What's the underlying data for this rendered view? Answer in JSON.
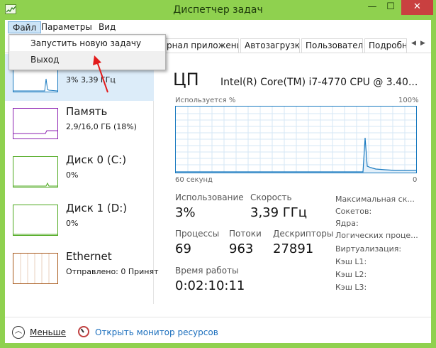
{
  "window": {
    "title": "Диспетчер задач",
    "controls": {
      "minimize": "—",
      "maximize": "☐",
      "close": "✕"
    }
  },
  "menubar": {
    "file": "Файл",
    "params": "Параметры",
    "view": "Вид"
  },
  "file_menu": {
    "items": [
      "Запустить новую задачу",
      "Выход"
    ]
  },
  "tabs": [
    "рнал приложений",
    "Автозагрузка",
    "Пользователи",
    "Подробно"
  ],
  "resources": [
    {
      "name": "ЦП",
      "value": "3%  3,39 ГГц",
      "color": "#1a7ac0"
    },
    {
      "name": "Память",
      "value": "2,9/16,0 ГБ (18%)",
      "color": "#8b1fb0"
    },
    {
      "name": "Диск 0 (C:)",
      "value": "0%",
      "color": "#4ca81c"
    },
    {
      "name": "Диск 1 (D:)",
      "value": "0%",
      "color": "#4ca81c"
    },
    {
      "name": "Ethernet",
      "value": "Отправлено: 0 Принят",
      "color": "#a7581a"
    }
  ],
  "cpu": {
    "heading": "ЦП",
    "model": "Intel(R) Core(TM) i7-4770 CPU @ 3.40...",
    "graph_top_label": "Используется %",
    "graph_max_label": "100%",
    "graph_bottom_left": "60 секунд",
    "graph_bottom_right": "0"
  },
  "stats": {
    "usage_label": "Использование",
    "usage_value": "3%",
    "speed_label": "Скорость",
    "speed_value": "3,39 ГГц",
    "processes_label": "Процессы",
    "processes_value": "69",
    "threads_label": "Потоки",
    "threads_value": "963",
    "handles_label": "Дескрипторы",
    "handles_value": "27891",
    "uptime_label": "Время работы",
    "uptime_value": "0:02:10:11"
  },
  "side_labels": [
    "Максимальная ск...",
    "Сокетов:",
    "Ядра:",
    "Логических проце...",
    "Виртуализация:",
    "Кэш L1:",
    "Кэш L2:",
    "Кэш L3:"
  ],
  "footer": {
    "less_label": "Меньше",
    "monitor_label": "Открыть монитор ресурсов"
  }
}
